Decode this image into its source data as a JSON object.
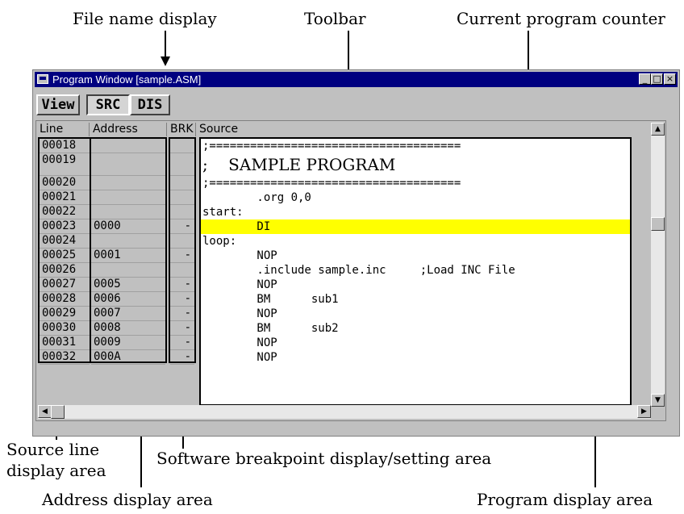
{
  "callouts": {
    "file_name": "File name display",
    "toolbar": "Toolbar",
    "pc": "Current program counter",
    "source_line_1": "Source line",
    "source_line_2": "display area",
    "breakpoint": "Software breakpoint display/setting area",
    "address": "Address display area",
    "program": "Program display area"
  },
  "window": {
    "title": "Program Window [sample.ASM]",
    "controls": {
      "minimize": "_",
      "maximize": "□",
      "close": "×"
    }
  },
  "toolbar": {
    "view": "View",
    "src": "SRC",
    "dis": "DIS"
  },
  "columns": {
    "line": "Line",
    "address": "Address",
    "brk": "BRK",
    "source": "Source"
  },
  "rows": [
    {
      "line": "00018",
      "address": "",
      "brk": ""
    },
    {
      "line": "00019",
      "address": "",
      "brk": ""
    },
    {
      "line": "00020",
      "address": "",
      "brk": ""
    },
    {
      "line": "00021",
      "address": "",
      "brk": ""
    },
    {
      "line": "00022",
      "address": "",
      "brk": ""
    },
    {
      "line": "00023",
      "address": "0000",
      "brk": "-"
    },
    {
      "line": "00024",
      "address": "",
      "brk": ""
    },
    {
      "line": "00025",
      "address": "0001",
      "brk": "-"
    },
    {
      "line": "00026",
      "address": "",
      "brk": ""
    },
    {
      "line": "00027",
      "address": "0005",
      "brk": "-"
    },
    {
      "line": "00028",
      "address": "0006",
      "brk": "-"
    },
    {
      "line": "00029",
      "address": "0007",
      "brk": "-"
    },
    {
      "line": "00030",
      "address": "0008",
      "brk": "-"
    },
    {
      "line": "00031",
      "address": "0009",
      "brk": "-"
    },
    {
      "line": "00032",
      "address": "000A",
      "brk": "-"
    }
  ],
  "source_lines": [
    ";=====================================",
    ";    SAMPLE PROGRAM",
    ";=====================================",
    "        .org 0,0",
    "start:",
    "        DI",
    "loop:",
    "        NOP",
    "        .include sample.inc     ;Load INC File",
    "        NOP",
    "        BM      sub1",
    "        NOP",
    "        BM      sub2",
    "        NOP",
    "        NOP"
  ],
  "current_pc_line": "00023",
  "highlight_color": "#ffff00",
  "titlebar_color": "#000080"
}
